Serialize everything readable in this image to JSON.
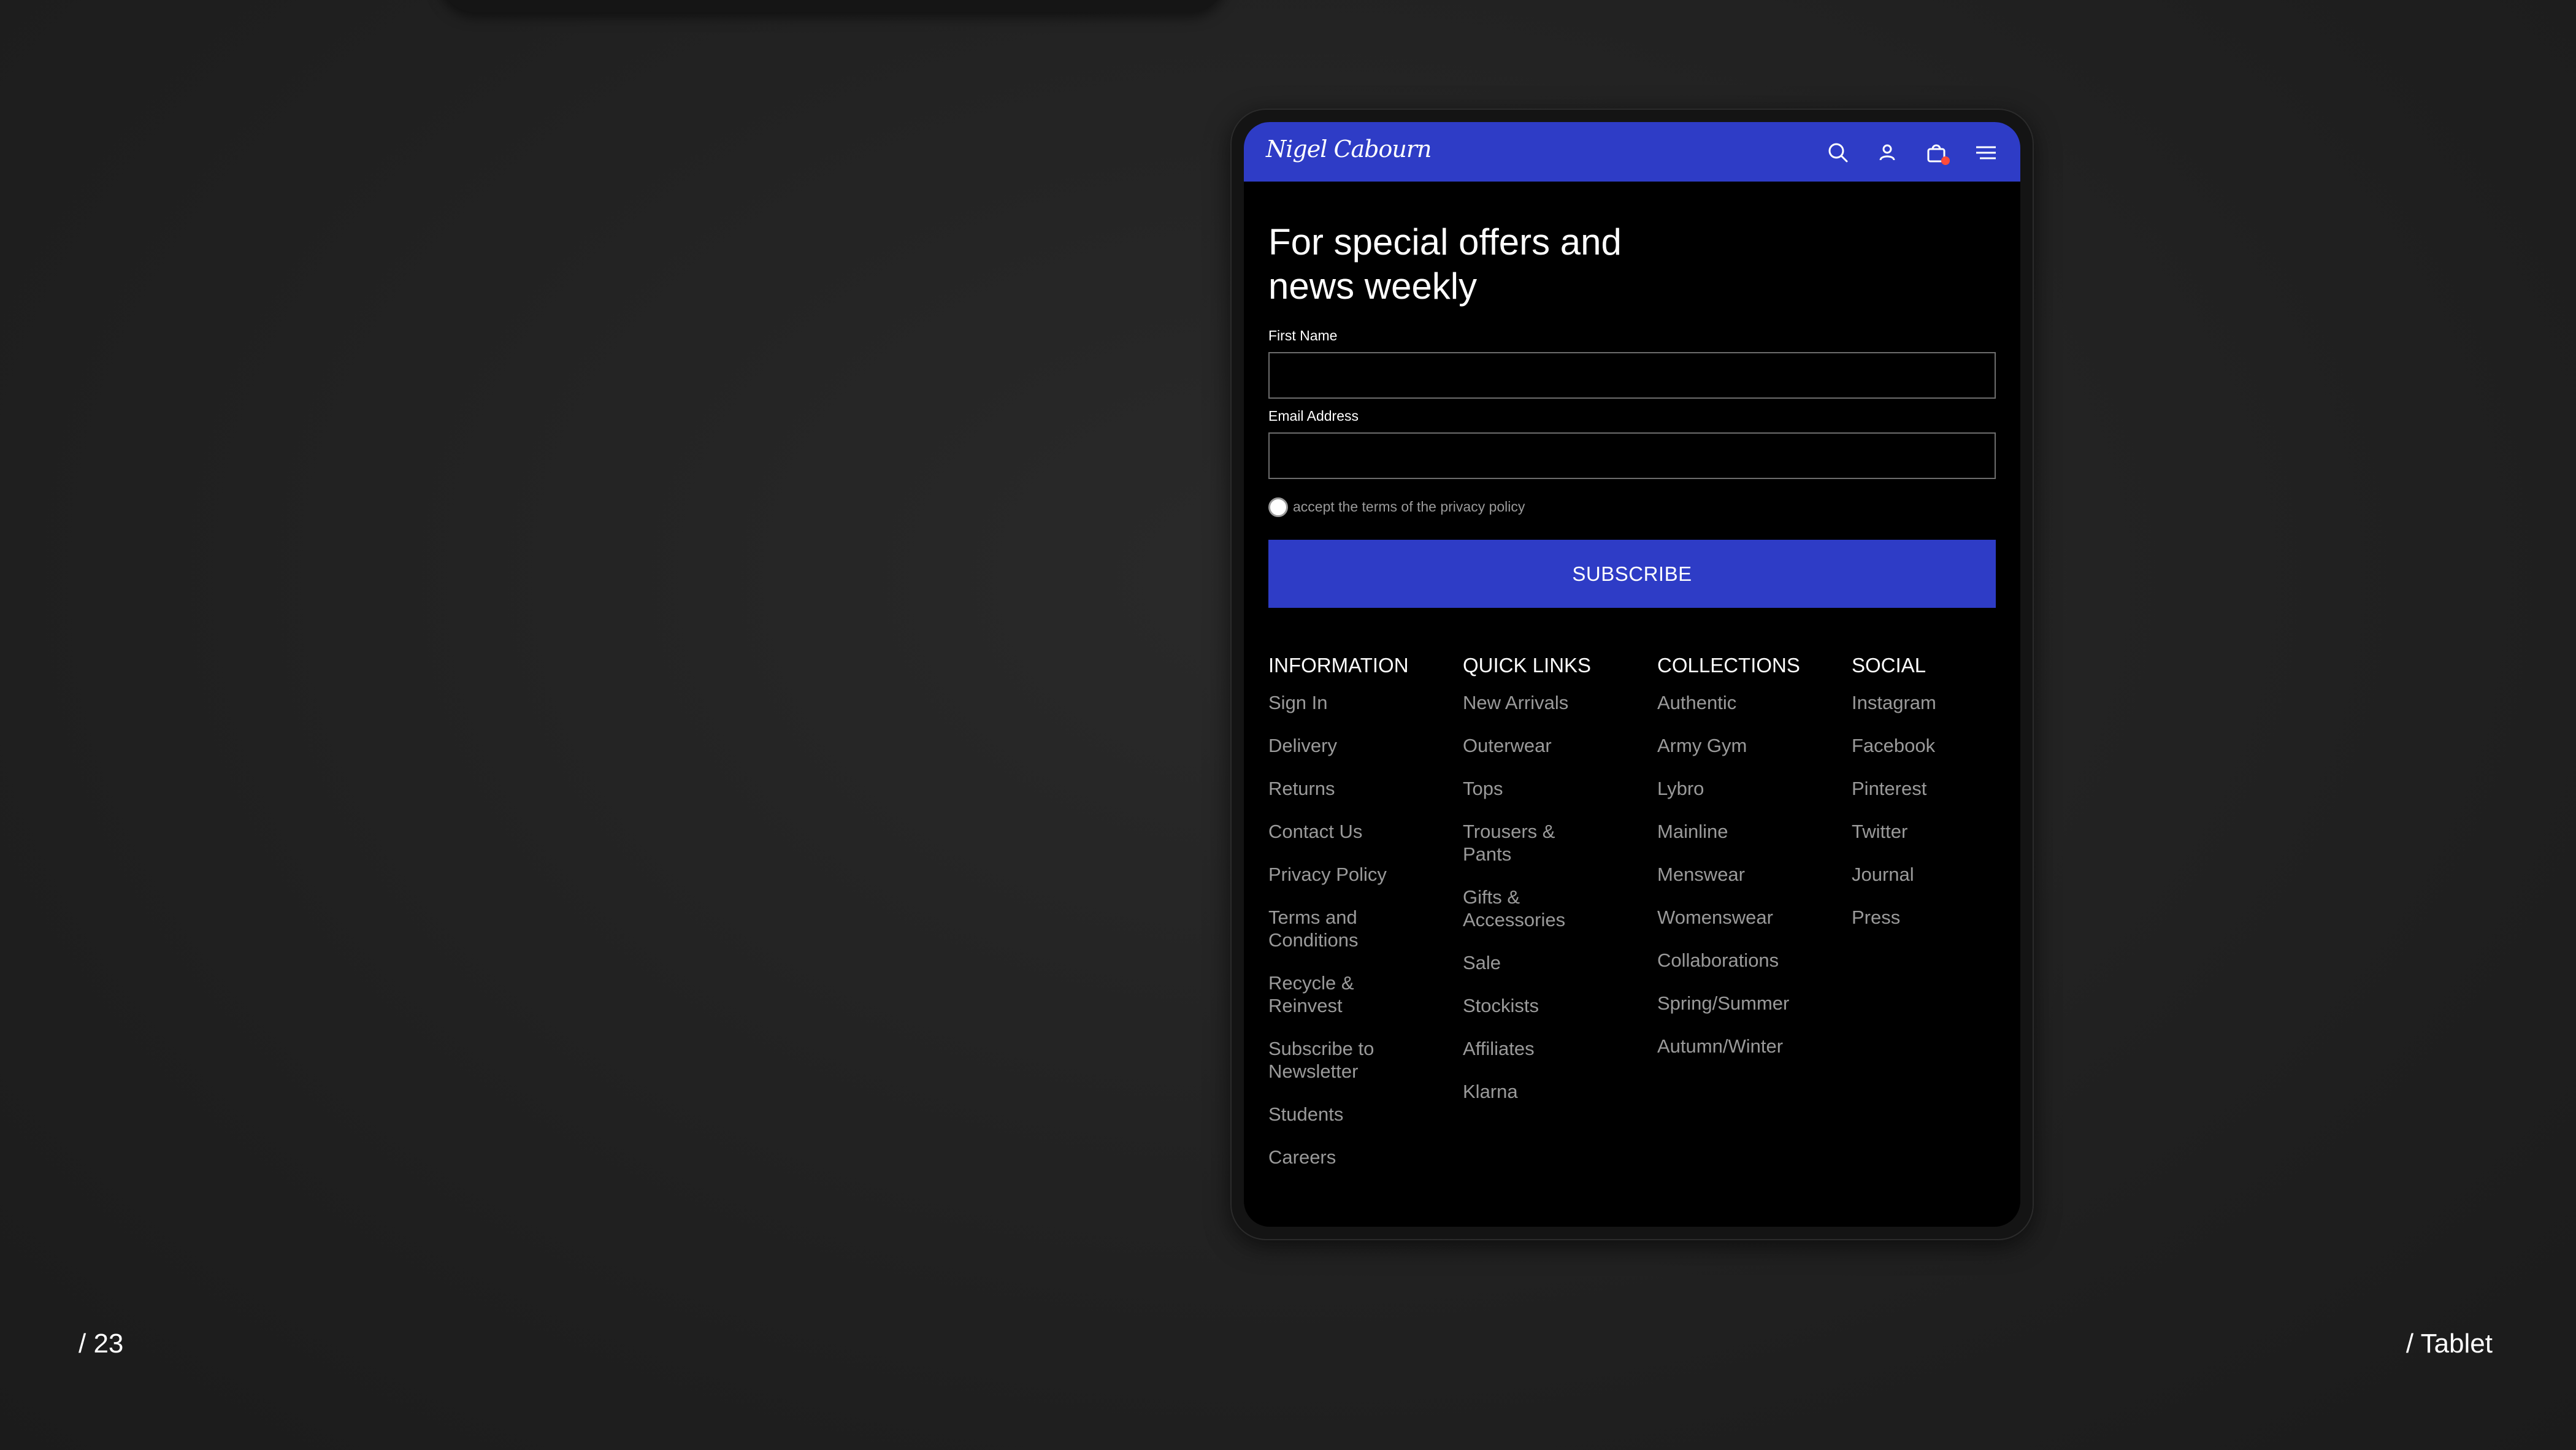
{
  "brand": {
    "logo": "Nigel Cabourn"
  },
  "header_icons": [
    "search-icon",
    "account-icon",
    "cart-icon",
    "menu-icon"
  ],
  "colors": {
    "brand_blue": "#2e3cc6",
    "background": "#222222",
    "cart_badge": "#ff4b3a"
  },
  "newsletter": {
    "headline": "For special offers and news weekly",
    "first_name_label": "First Name",
    "first_name_value": "",
    "email_label": "Email Address",
    "email_value": "",
    "consent_text": "accept the terms of the privacy policy",
    "subscribe_label": "SUBSCRIBE"
  },
  "footer": {
    "columns": [
      {
        "title": "INFORMATION",
        "items": [
          "Sign In",
          "Delivery",
          "Returns",
          "Contact Us",
          "Privacy Policy",
          "Terms and Conditions",
          "Recycle & Reinvest",
          "Subscribe to Newsletter",
          "Students",
          "Careers"
        ]
      },
      {
        "title": "QUICK LINKS",
        "items": [
          "New Arrivals",
          "Outerwear",
          "Tops",
          "Trousers & Pants",
          "Gifts & Accessories",
          "Sale",
          "Stockists",
          "Affiliates",
          "Klarna"
        ]
      },
      {
        "title": "COLLECTIONS",
        "items": [
          "Authentic",
          "Army Gym",
          "Lybro",
          "Mainline",
          "Menswear",
          "Womenswear",
          "Collaborations",
          "Spring/Summer",
          "Autumn/Winter"
        ]
      },
      {
        "title": "SOCIAL",
        "items": [
          "Instagram",
          "Facebook",
          "Pinterest",
          "Twitter",
          "Journal",
          "Press"
        ]
      }
    ]
  },
  "slide": {
    "page_number": "/ 23",
    "device_label": "/ Tablet"
  }
}
